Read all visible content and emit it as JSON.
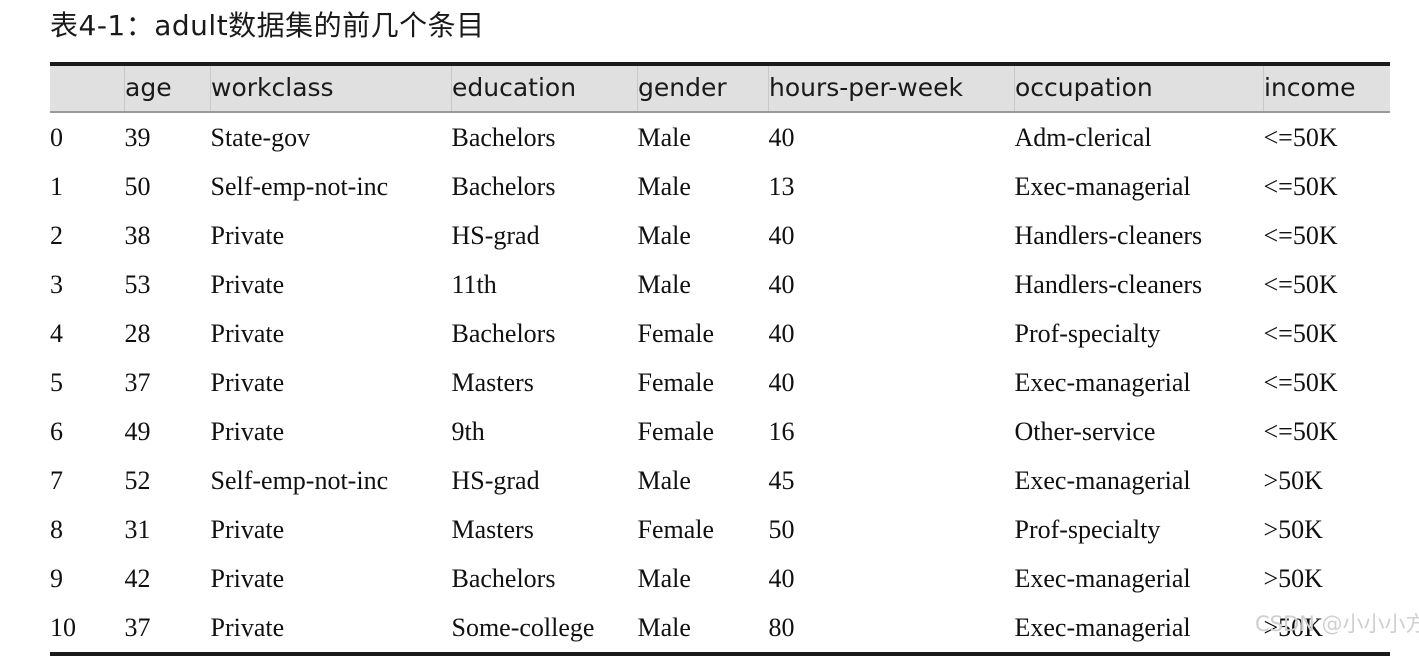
{
  "caption": "表4-1：adult数据集的前几个条目",
  "table": {
    "index_header": "",
    "columns": [
      "age",
      "workclass",
      "education",
      "gender",
      "hours-per-week",
      "occupation",
      "income"
    ],
    "rows": [
      {
        "index": "0",
        "age": "39",
        "workclass": "State-gov",
        "education": "Bachelors",
        "gender": "Male",
        "hours_per_week": "40",
        "occupation": "Adm-clerical",
        "income": "<=50K"
      },
      {
        "index": "1",
        "age": "50",
        "workclass": "Self-emp-not-inc",
        "education": "Bachelors",
        "gender": "Male",
        "hours_per_week": "13",
        "occupation": "Exec-managerial",
        "income": "<=50K"
      },
      {
        "index": "2",
        "age": "38",
        "workclass": "Private",
        "education": "HS-grad",
        "gender": "Male",
        "hours_per_week": "40",
        "occupation": "Handlers-cleaners",
        "income": "<=50K"
      },
      {
        "index": "3",
        "age": "53",
        "workclass": "Private",
        "education": "11th",
        "gender": "Male",
        "hours_per_week": "40",
        "occupation": "Handlers-cleaners",
        "income": "<=50K"
      },
      {
        "index": "4",
        "age": "28",
        "workclass": "Private",
        "education": "Bachelors",
        "gender": "Female",
        "hours_per_week": "40",
        "occupation": "Prof-specialty",
        "income": "<=50K"
      },
      {
        "index": "5",
        "age": "37",
        "workclass": "Private",
        "education": "Masters",
        "gender": "Female",
        "hours_per_week": "40",
        "occupation": "Exec-managerial",
        "income": "<=50K"
      },
      {
        "index": "6",
        "age": "49",
        "workclass": "Private",
        "education": "9th",
        "gender": "Female",
        "hours_per_week": "16",
        "occupation": "Other-service",
        "income": "<=50K"
      },
      {
        "index": "7",
        "age": "52",
        "workclass": "Self-emp-not-inc",
        "education": "HS-grad",
        "gender": "Male",
        "hours_per_week": "45",
        "occupation": "Exec-managerial",
        "income": ">50K"
      },
      {
        "index": "8",
        "age": "31",
        "workclass": "Private",
        "education": "Masters",
        "gender": "Female",
        "hours_per_week": "50",
        "occupation": "Prof-specialty",
        "income": ">50K"
      },
      {
        "index": "9",
        "age": "42",
        "workclass": "Private",
        "education": "Bachelors",
        "gender": "Male",
        "hours_per_week": "40",
        "occupation": "Exec-managerial",
        "income": ">50K"
      },
      {
        "index": "10",
        "age": "37",
        "workclass": "Private",
        "education": "Some-college",
        "gender": "Male",
        "hours_per_week": "80",
        "occupation": "Exec-managerial",
        "income": ">50K"
      }
    ]
  },
  "watermark": "CSDN @小小小方",
  "colors": {
    "header_background": "#e0e0e0",
    "rule": "#1a1a1a",
    "text": "#101010",
    "watermark": "#cfcfcf"
  }
}
